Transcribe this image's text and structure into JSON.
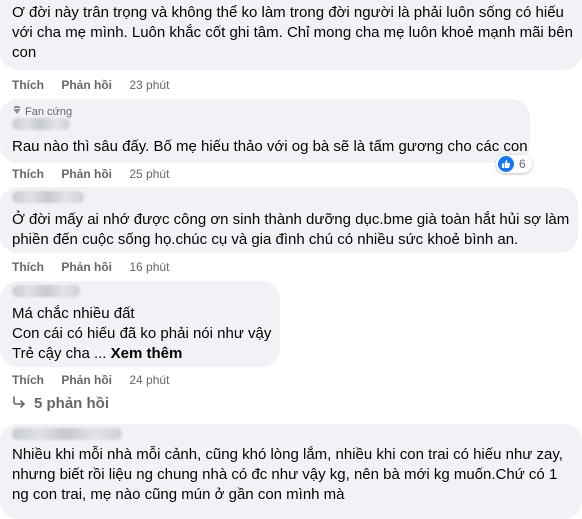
{
  "comments": [
    {
      "lines": [
        "Ơ đời này trân trọng và không thể ko làm trong đời người là phải luôn sống có hiếu",
        "với cha mẹ mình. Luôn khắc cốt ghi tâm. Chỉ mong cha mẹ luôn khoẻ mạnh mãi bên",
        "con"
      ],
      "like": "Thích",
      "reply": "Phản hồi",
      "time": "23 phút"
    },
    {
      "badge": "Fan cứng",
      "lines": [
        "Rau nào thì sâu đấy. Bố mẹ hiếu thảo với og bà sẽ là tấm gương cho các con"
      ],
      "reaction_count": "6",
      "like": "Thích",
      "reply": "Phản hồi",
      "time": "25 phút"
    },
    {
      "lines": [
        "Ở đời mấy ai nhớ được công ơn sinh thành dưỡng dục.bme già toàn hắt hủi sợ làm",
        "phiền đến cuộc sống họ.chúc cụ và gia đình chú có nhiều sức khoẻ bình an."
      ],
      "like": "Thích",
      "reply": "Phản hồi",
      "time": "16 phút"
    },
    {
      "lines": [
        "Má chắc nhiều đất",
        "Con cái có hiếu đã ko phải nói như vậy",
        "Trẻ cậy cha ..."
      ],
      "see_more": "Xem thêm",
      "like": "Thích",
      "reply": "Phản hồi",
      "time": "24 phút",
      "replies_label": "5 phản hồi"
    },
    {
      "lines": [
        "Nhiều khi mỗi nhà mỗi cảnh, cũng khó lòng lắm, nhiều khi con trai có hiếu như zay,",
        "nhưng biết rồi liệu ng chung nhà có đc như vậy kg, nên bà mới kg muốn.Chứ có 1",
        "ng con trai, mẹ nào cũng mún ở gần con mình mà"
      ]
    }
  ],
  "colors": {
    "bubble": "#f0f2f5",
    "secondary_text": "#65676b",
    "like_blue": "#1877f2"
  },
  "icons": [
    "gem-badge-icon",
    "like-reaction-icon",
    "reply-arrow-icon"
  ]
}
